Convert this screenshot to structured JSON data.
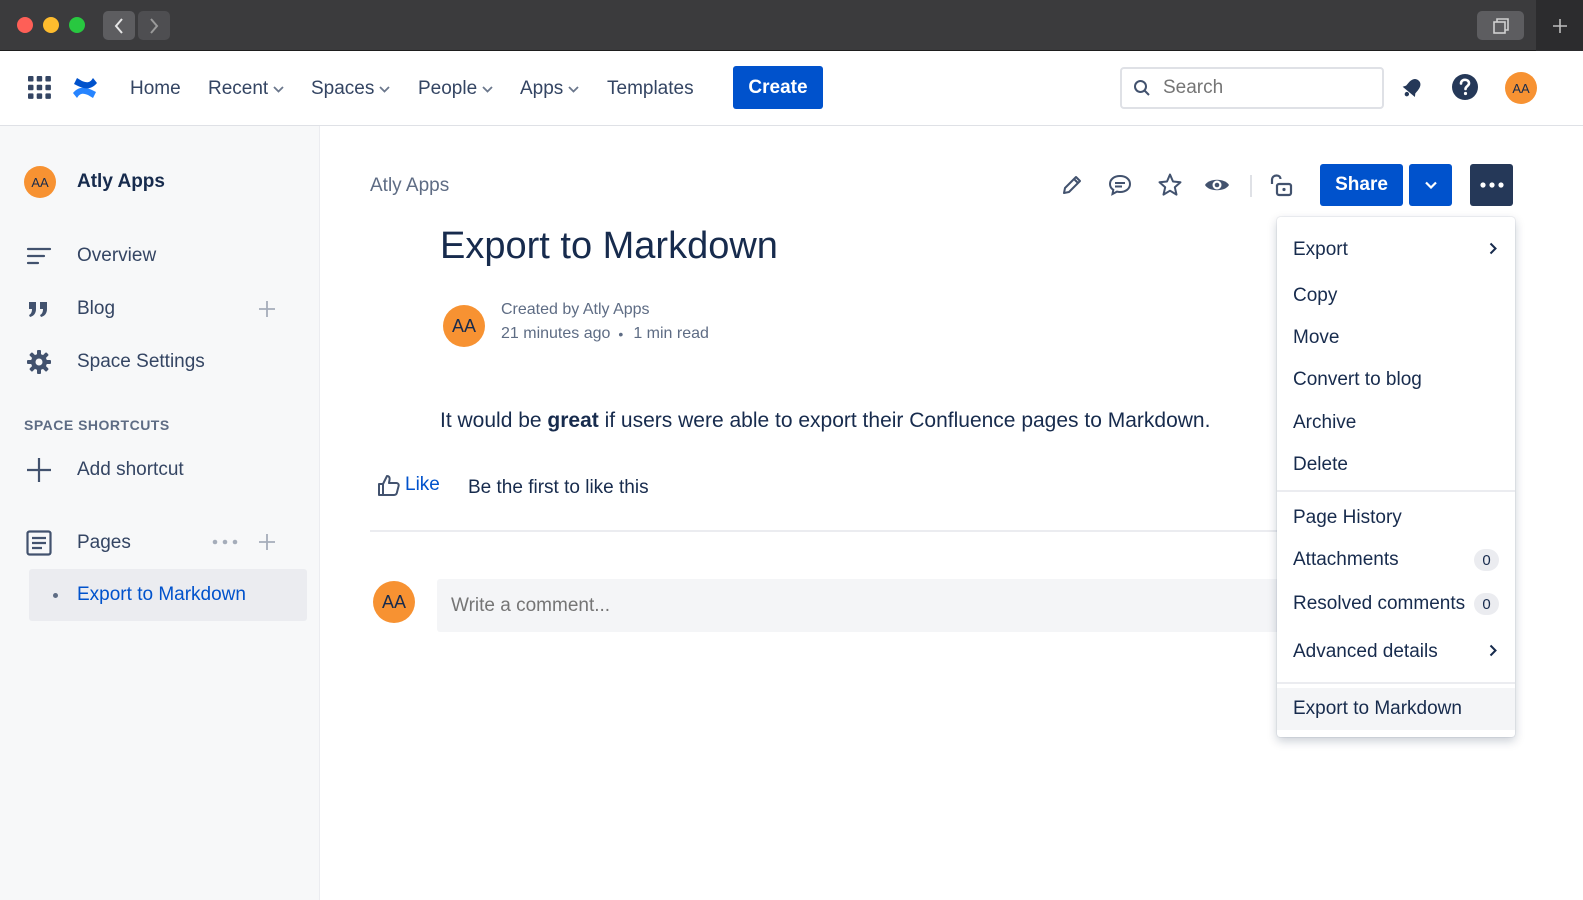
{
  "nav": {
    "home": "Home",
    "recent": "Recent",
    "spaces": "Spaces",
    "people": "People",
    "apps": "Apps",
    "templates": "Templates",
    "create": "Create",
    "search_placeholder": "Search",
    "user_initials": "AA"
  },
  "sidebar": {
    "space_initials": "AA",
    "space_name": "Atly Apps",
    "overview": "Overview",
    "blog": "Blog",
    "space_settings": "Space Settings",
    "shortcuts_title": "SPACE SHORTCUTS",
    "add_shortcut": "Add shortcut",
    "pages": "Pages",
    "selected_page": "Export to Markdown"
  },
  "page": {
    "breadcrumb": "Atly Apps",
    "share": "Share",
    "title": "Export to Markdown",
    "author_initials": "AA",
    "created_by": "Created by Atly Apps",
    "time_ago": "21 minutes ago",
    "read_time": "1 min read",
    "body_before": "It would be ",
    "body_bold": "great",
    "body_after": " if users were able to export their Confluence pages to Markdown.",
    "like": "Like",
    "like_status": "Be the first to like this",
    "commenter_initials": "AA",
    "comment_placeholder": "Write a comment..."
  },
  "menu": {
    "export": "Export",
    "copy": "Copy",
    "move": "Move",
    "convert": "Convert to blog",
    "archive": "Archive",
    "delete": "Delete",
    "history": "Page History",
    "attachments": "Attachments",
    "attachments_count": "0",
    "resolved": "Resolved comments",
    "resolved_count": "0",
    "advanced": "Advanced details",
    "export_md": "Export to Markdown"
  },
  "colors": {
    "brand_blue": "#0052cc",
    "avatar_orange": "#f79232",
    "dark_button": "#253858"
  }
}
